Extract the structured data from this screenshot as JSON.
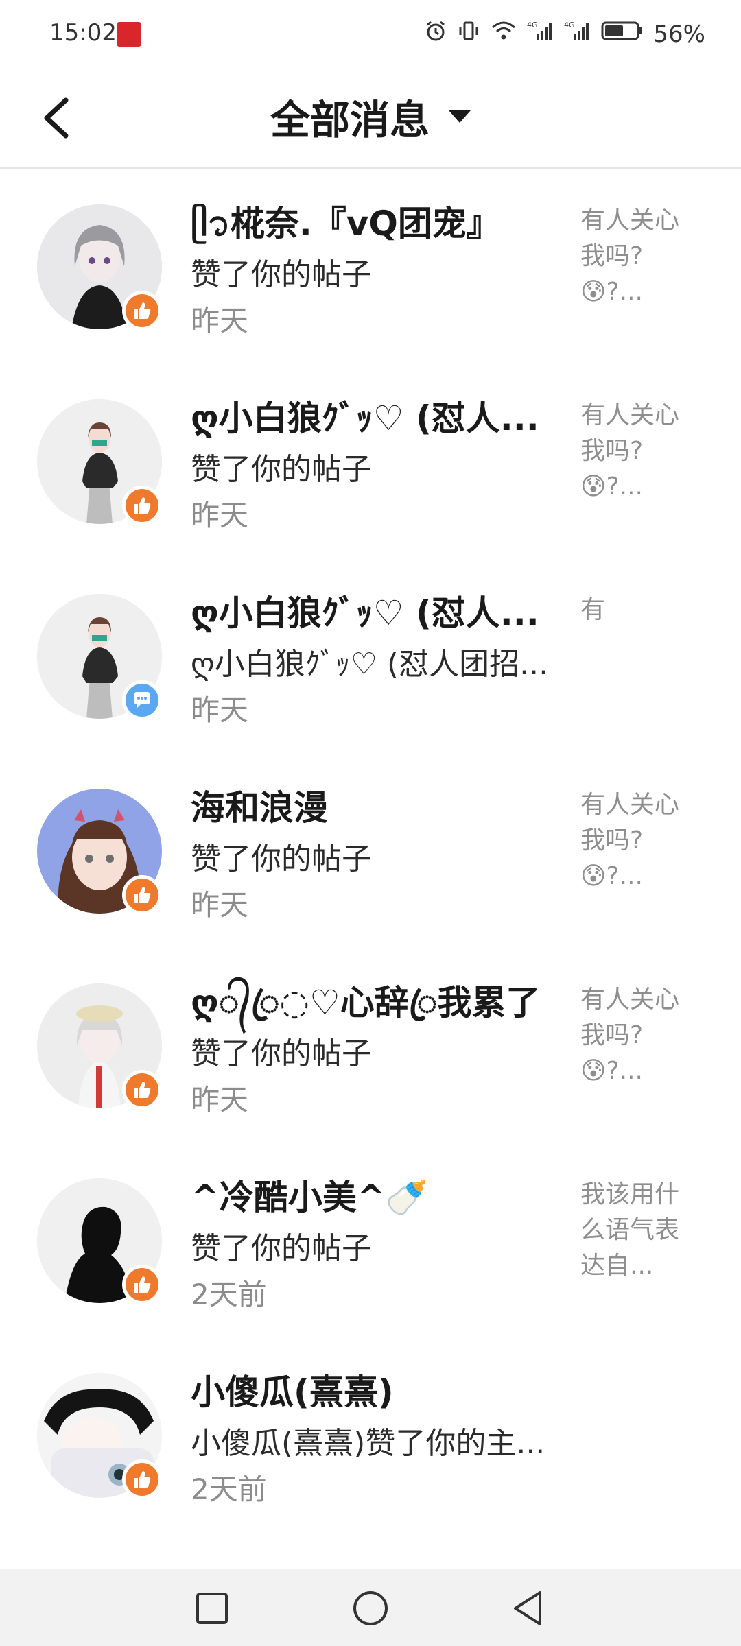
{
  "status_bar": {
    "time": "15:02",
    "battery": "56%",
    "network1": "4G",
    "network2": "4G"
  },
  "header": {
    "title": "全部消息"
  },
  "messages": [
    {
      "name": "ᥫ᭡椛奈.『vQ团宠』",
      "action": "赞了你的帖子",
      "time": "昨天",
      "snippet": "有人关心我吗?😰?...",
      "badge": "like"
    },
    {
      "name": "ღ小白狼ｸﾞｯ♡ (怼人...",
      "action": "赞了你的帖子",
      "time": "昨天",
      "snippet": "有人关心我吗?😰?...",
      "badge": "like"
    },
    {
      "name": "ღ小白狼ｸﾞｯ♡ (怼人...",
      "action": "ღ小白狼ｸﾞｯ♡ (怼人团招...",
      "time": "昨天",
      "snippet": "有",
      "badge": "comment"
    },
    {
      "name": "海和浪漫",
      "action": "赞了你的帖子",
      "time": "昨天",
      "snippet": "有人关心我吗?😰?...",
      "badge": "like"
    },
    {
      "name": "ღ᭄ꦿ◌♡心辞ꦿ我累了",
      "action": "赞了你的帖子",
      "time": "昨天",
      "snippet": "有人关心我吗?😰?...",
      "badge": "like"
    },
    {
      "name": "^冷酷小美^🍼",
      "action": "赞了你的帖子",
      "time": "2天前",
      "snippet": "我该用什么语气表达自...",
      "badge": "like"
    },
    {
      "name": "小傻瓜(熹熹)",
      "action": "小傻瓜(熹熹)赞了你的主...",
      "time": "2天前",
      "snippet": "",
      "badge": "like"
    }
  ],
  "colors": {
    "like_badge": "#f07a2b",
    "comment_badge": "#5aa7f2"
  },
  "icons": {
    "back": "chevron-left-icon",
    "dropdown": "caret-down-icon",
    "like": "thumbs-up-icon",
    "comment": "speech-bubble-icon"
  }
}
